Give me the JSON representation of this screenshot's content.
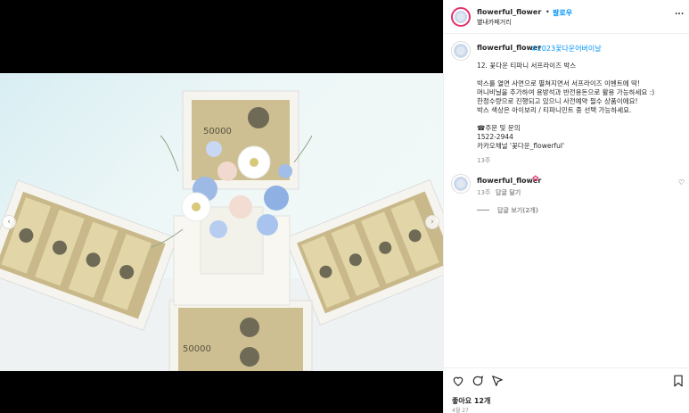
{
  "header": {
    "username": "flowerful_flower",
    "separator": "•",
    "follow_label": "팔로우",
    "location": "별내카페거리",
    "more_label": "..."
  },
  "caption": {
    "username": "flowerful_flower",
    "hashtag": "#2023꽃다운어버이날",
    "lines": [
      "12. 꽃다운 티파니 서프라이즈 박스",
      "",
      "박스를 열면 사면으로 펼쳐지면서 서프라이즈 이벤트에 딱!",
      "머니비닐을 추가하여 용방석과 반전용돈으로 활용 가능하세요 :)",
      "한정수량으로 진행되고 있으니 사전예약 필수 상품이에요!",
      "박스 색상은 아이보리 / 티파니민트 중 선택 가능하세요.",
      "",
      "☎주문 및 문의",
      "1522-2944",
      "카카오채널 '꽃다운_flowerful'"
    ],
    "time": "13주"
  },
  "comment": {
    "username": "flowerful_flower",
    "time": "13주",
    "reply_label": "답글 달기",
    "view_replies_label": "답글 보기(2개)"
  },
  "footer": {
    "likes": "좋아요 12개",
    "date": "4월 27"
  },
  "media": {
    "banknote_label": "50000"
  }
}
